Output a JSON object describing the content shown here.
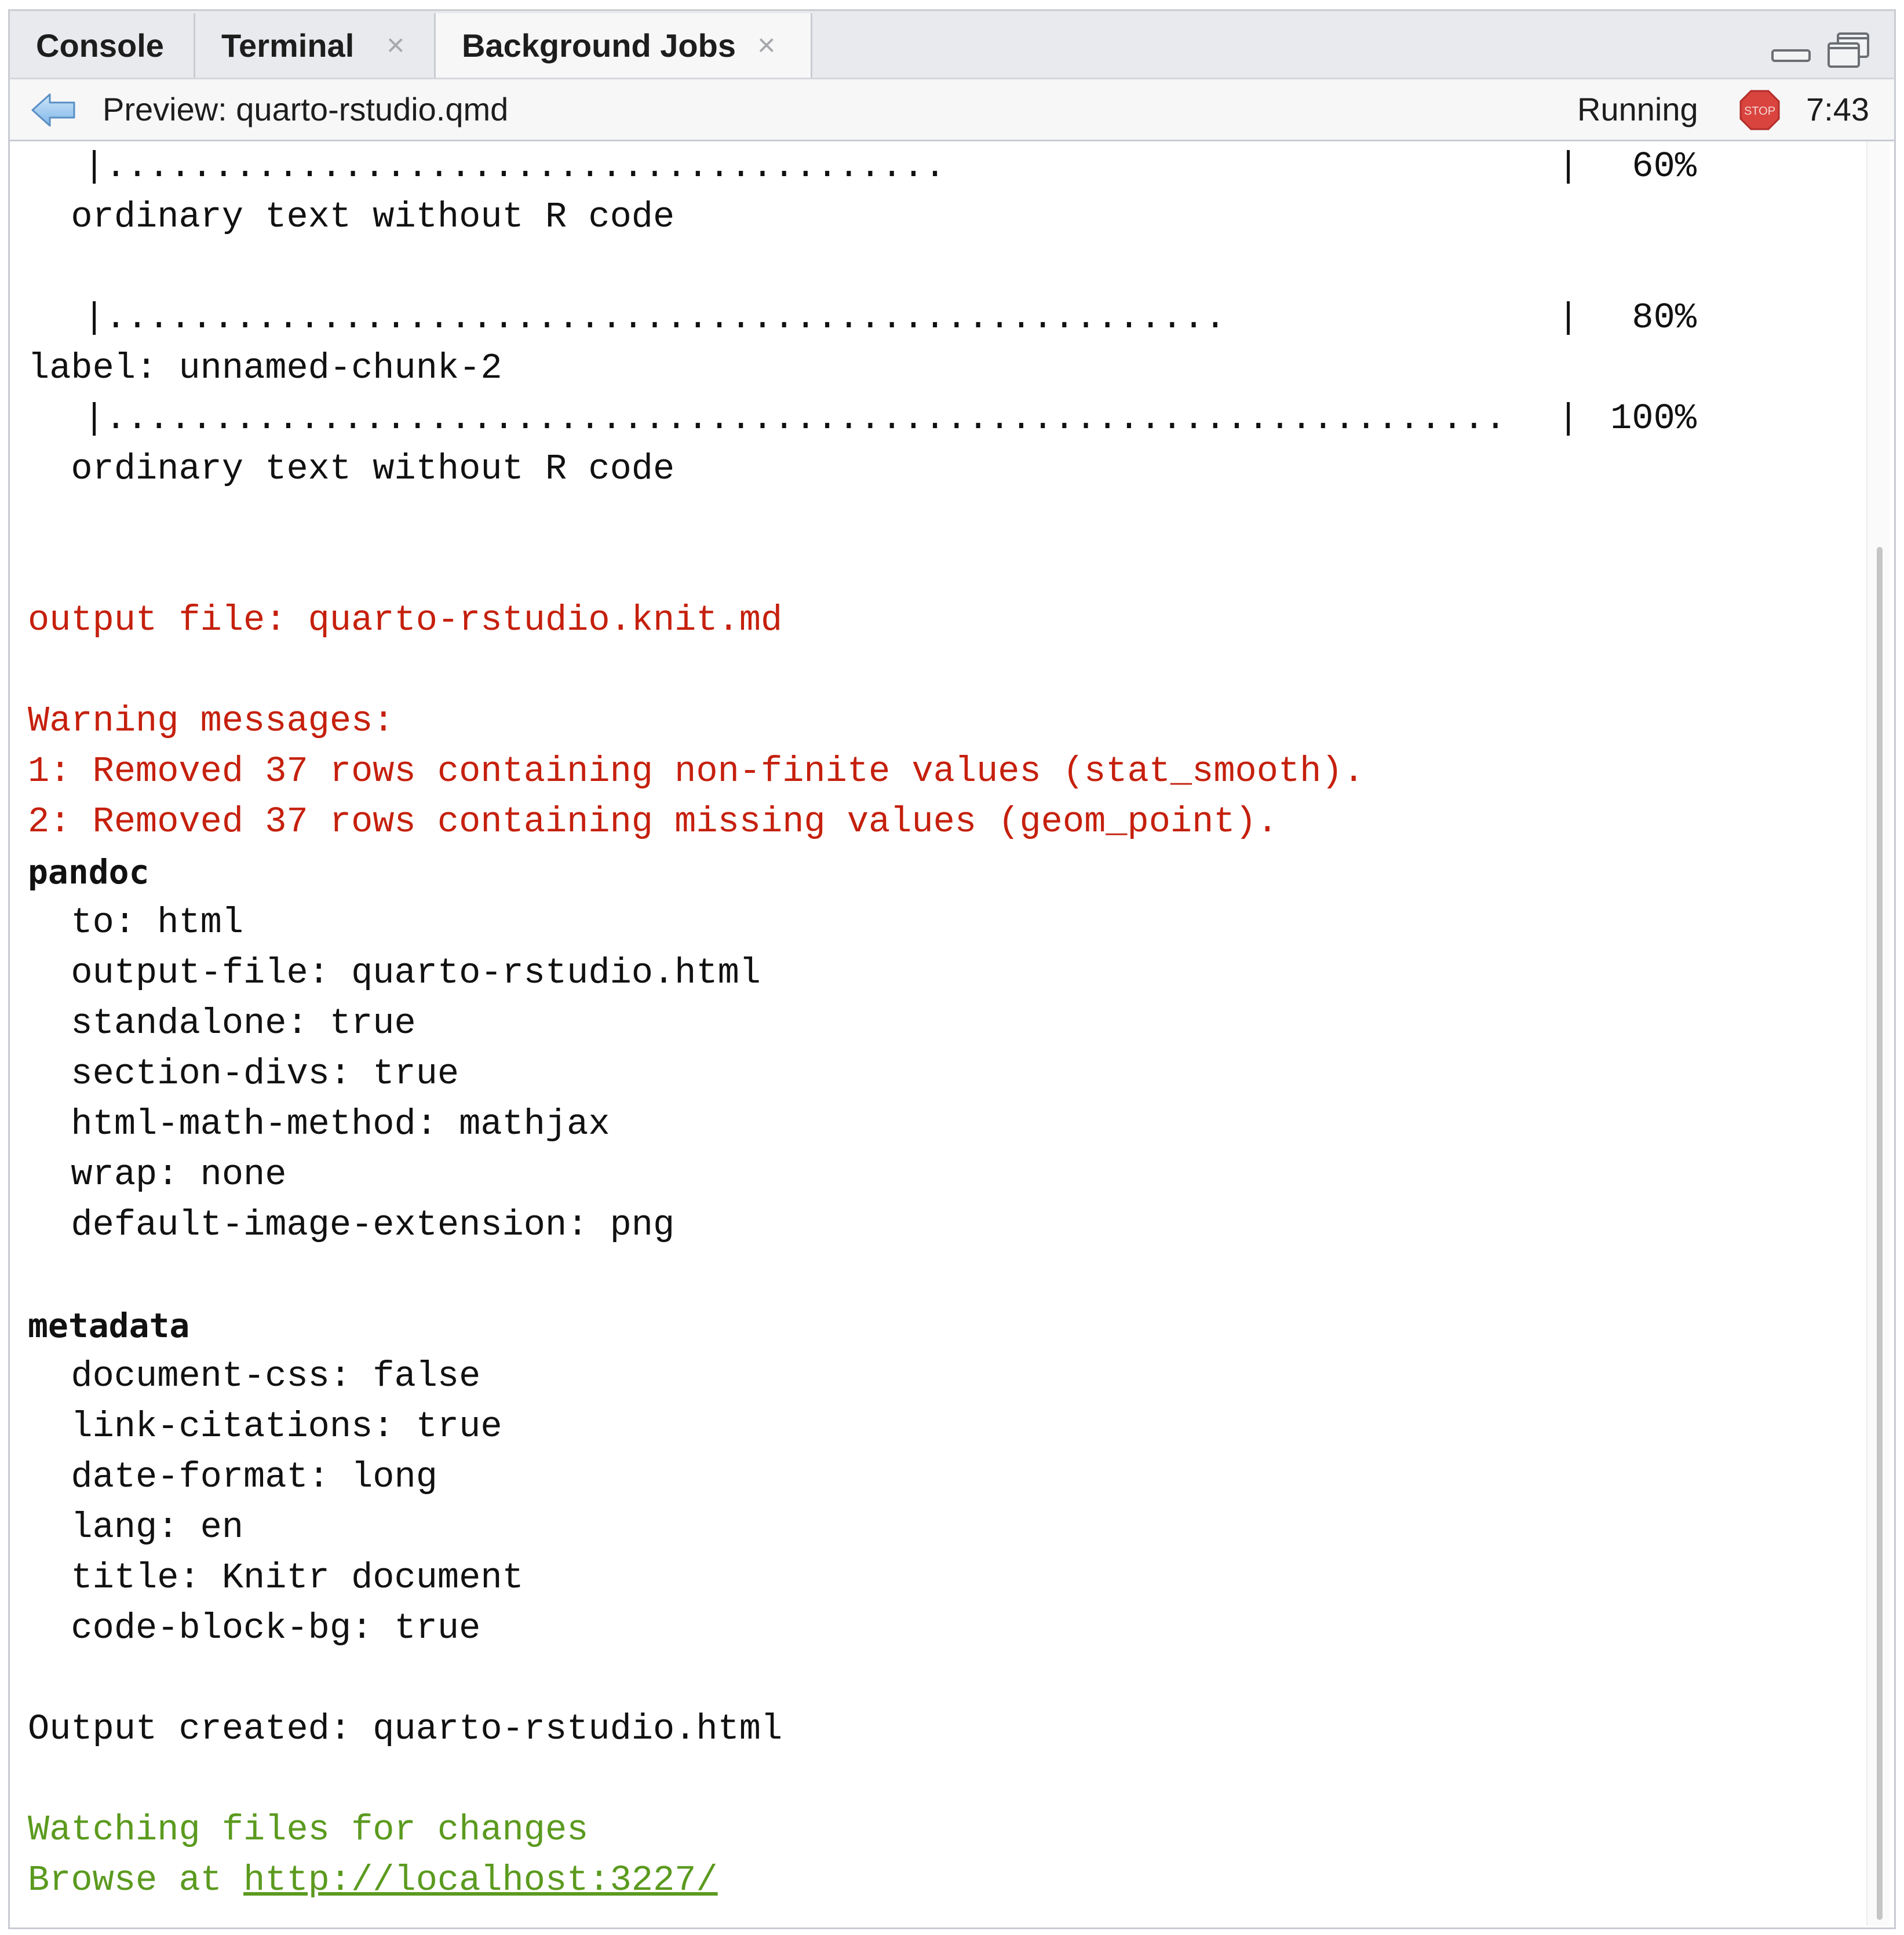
{
  "tabs": [
    {
      "label": "Console",
      "closable": false,
      "active": false
    },
    {
      "label": "Terminal",
      "closable": true,
      "active": false
    },
    {
      "label": "Background Jobs",
      "closable": true,
      "active": true
    }
  ],
  "tab_close_glyph": "×",
  "window_controls": {
    "minimize_icon": "minimize-icon",
    "maximize_icon": "restore-icon"
  },
  "job": {
    "title": "Preview: quarto-rstudio.qmd",
    "status": "Running",
    "stop_label": "STOP",
    "elapsed": "7:43",
    "back_icon": "back-arrow-icon"
  },
  "colors": {
    "error_red": "#c5200d",
    "success_green": "#5b9a1f",
    "stop_red": "#d9443f"
  },
  "progress": [
    {
      "bar": "|.......................................",
      "end": "|",
      "pct": "60%"
    },
    {
      "bar": "|....................................................",
      "end": "|",
      "pct": "80%"
    },
    {
      "bar": "|.................................................................",
      "end": "|",
      "pct": "100%"
    }
  ],
  "output": {
    "ordinary1": "  ordinary text without R code",
    "label_line": "label: unnamed-chunk-2",
    "ordinary2": "  ordinary text without R code",
    "output_file": "output file: quarto-rstudio.knit.md",
    "warning_header": "Warning messages:",
    "warning1": "1: Removed 37 rows containing non-finite values (stat_smooth).",
    "warning2": "2: Removed 37 rows containing missing values (geom_point).",
    "pandoc_header": "pandoc",
    "pandoc": [
      "  to: html",
      "  output-file: quarto-rstudio.html",
      "  standalone: true",
      "  section-divs: true",
      "  html-math-method: mathjax",
      "  wrap: none",
      "  default-image-extension: png"
    ],
    "metadata_header": "metadata",
    "metadata": [
      "  document-css: false",
      "  link-citations: true",
      "  date-format: long",
      "  lang: en",
      "  title: Knitr document",
      "  code-block-bg: true"
    ],
    "output_created": "Output created: quarto-rstudio.html",
    "watching": "Watching files for changes",
    "browse_prefix": "Browse at ",
    "browse_url": "http://localhost:3227/"
  }
}
